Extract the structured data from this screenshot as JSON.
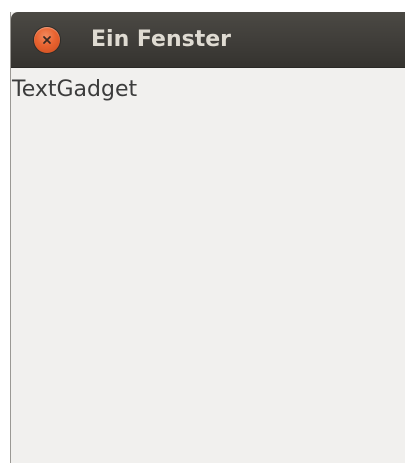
{
  "window": {
    "title": "Ein Fenster",
    "close_icon": "close-icon",
    "colors": {
      "titlebar": "#3f3d39",
      "title_text": "#dfdbd2",
      "close_button": "#e8622f",
      "content_background": "#f1f0ee",
      "content_text": "#3c3c3c"
    }
  },
  "content": {
    "text_gadget": "TextGadget"
  }
}
